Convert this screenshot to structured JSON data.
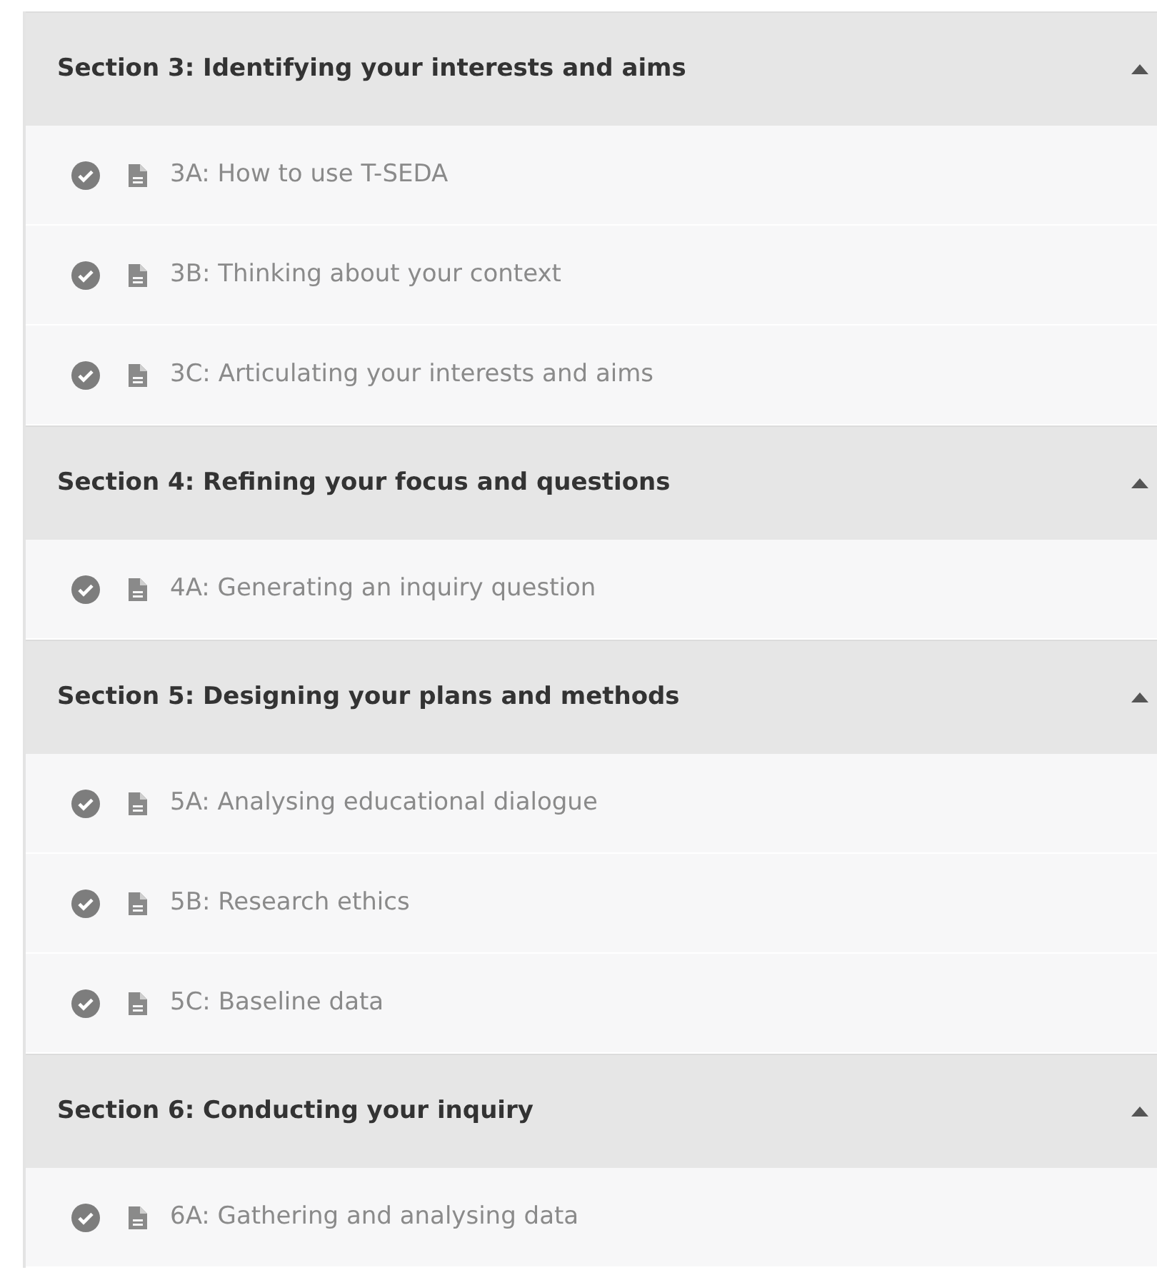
{
  "sections": [
    {
      "title": "Section 3: Identifying your interests and aims",
      "expanded": true,
      "items": [
        {
          "label": "3A: How to use T-SEDA",
          "completed": true
        },
        {
          "label": "3B: Thinking about your context",
          "completed": true
        },
        {
          "label": "3C: Articulating your interests and aims",
          "completed": true
        }
      ]
    },
    {
      "title": "Section 4: Refining your focus and questions",
      "expanded": true,
      "items": [
        {
          "label": "4A: Generating an inquiry question",
          "completed": true
        }
      ]
    },
    {
      "title": "Section 5: Designing your plans and methods",
      "expanded": true,
      "items": [
        {
          "label": "5A: Analysing educational dialogue",
          "completed": true
        },
        {
          "label": "5B: Research ethics",
          "completed": true
        },
        {
          "label": "5C: Baseline data",
          "completed": true
        }
      ]
    },
    {
      "title": "Section 6: Conducting your inquiry",
      "expanded": true,
      "items": [
        {
          "label": "6A: Gathering and analysing data",
          "completed": true
        }
      ]
    }
  ]
}
